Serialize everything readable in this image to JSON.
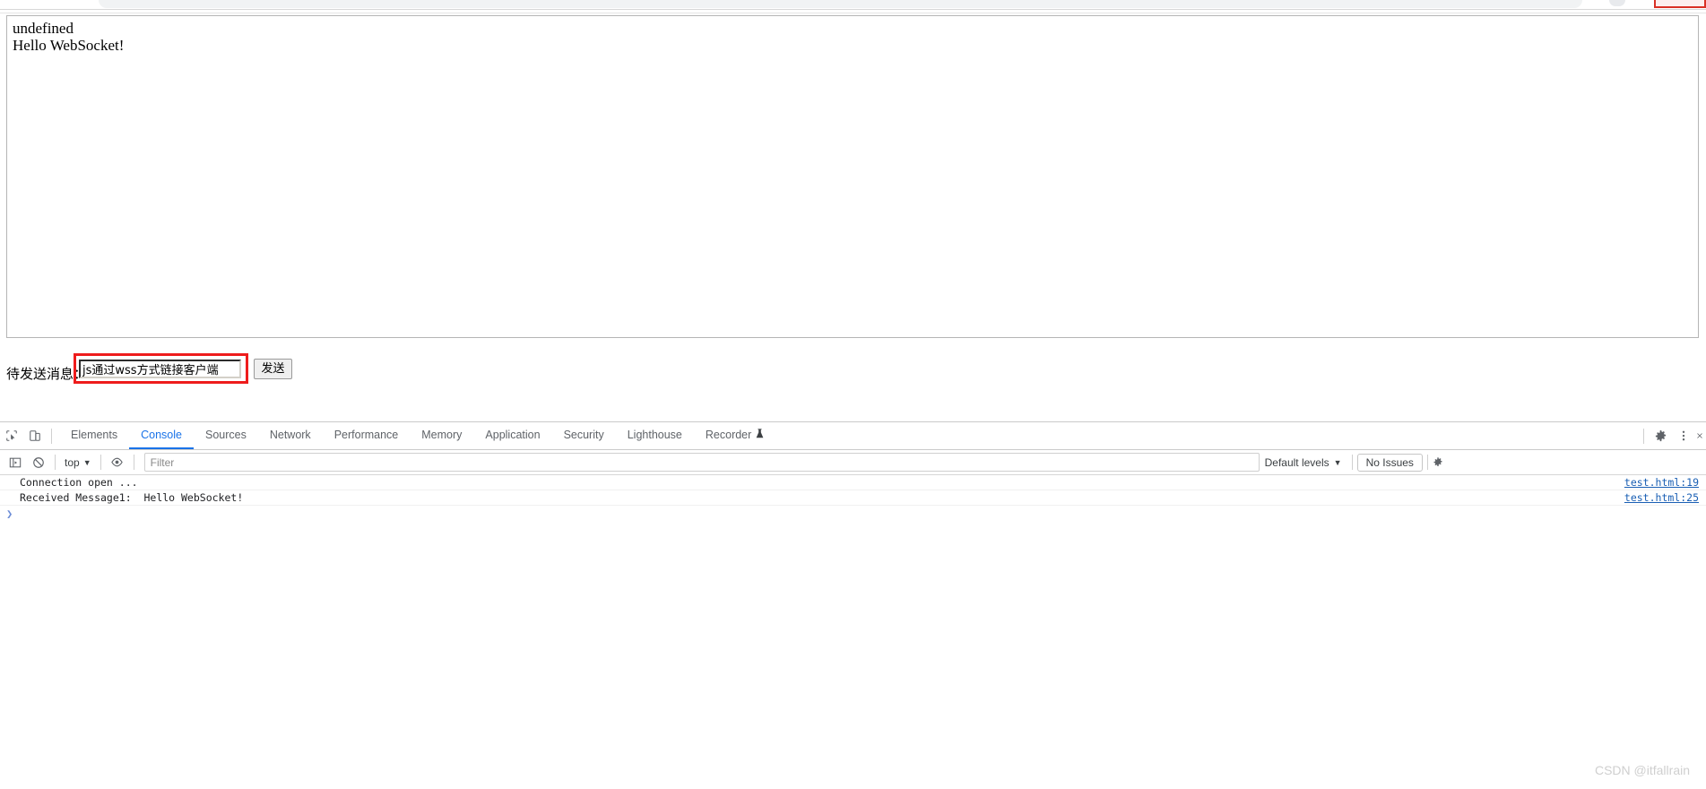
{
  "browser_chrome": {
    "omnibox_icon": "omnibox-fragment",
    "profile_icon": "profile-avatar-fragment",
    "highlight_icon": "red-annotation-fragment"
  },
  "page": {
    "messages": [
      "undefined",
      "Hello WebSocket!"
    ],
    "send_row": {
      "label": "待发送消息：",
      "input_value": "js通过wss方式链接客户端",
      "input_placeholder": "",
      "send_button": "发送"
    }
  },
  "devtools": {
    "toolbar": {
      "inspect_icon": "inspect-element-icon",
      "device_icon": "device-toolbar-icon",
      "settings_icon": "gear-icon",
      "more_icon": "more-vertical-icon",
      "close_icon": "close-icon",
      "tabs": [
        {
          "label": "Elements",
          "active": false
        },
        {
          "label": "Console",
          "active": true
        },
        {
          "label": "Sources",
          "active": false
        },
        {
          "label": "Network",
          "active": false
        },
        {
          "label": "Performance",
          "active": false
        },
        {
          "label": "Memory",
          "active": false
        },
        {
          "label": "Application",
          "active": false
        },
        {
          "label": "Security",
          "active": false
        },
        {
          "label": "Lighthouse",
          "active": false
        },
        {
          "label": "Recorder",
          "active": false,
          "icon": "experiment-flask-icon"
        }
      ]
    },
    "filterbar": {
      "sidebar_icon": "console-sidebar-icon",
      "clear_icon": "clear-console-icon",
      "context": "top",
      "context_caret": "▼",
      "eye_icon": "live-expression-eye-icon",
      "filter_placeholder": "Filter",
      "filter_value": "",
      "levels": "Default levels",
      "levels_caret": "▼",
      "issues": "No Issues",
      "settings_icon": "gear-icon"
    },
    "console_rows": [
      {
        "text": "Connection open ...",
        "source": "test.html:19"
      },
      {
        "text": "Received Message1:  Hello WebSocket!",
        "source": "test.html:25"
      }
    ],
    "prompt_symbol": "❯"
  },
  "watermark": "CSDN @itfallrain",
  "colors": {
    "accent_blue": "#1a73e8",
    "annotation_red": "#ee1c1c",
    "link_blue": "#1a5fb4",
    "watermark_grey": "#cfcfcf"
  }
}
